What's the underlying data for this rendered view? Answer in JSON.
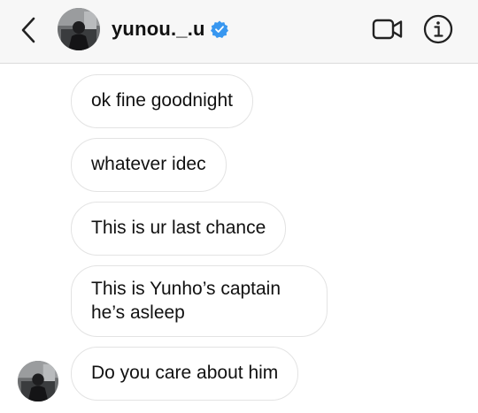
{
  "header": {
    "username": "yunou._.u",
    "verified": true,
    "icons": {
      "back": "chevron-left-icon",
      "verified": "verified-badge-icon",
      "video": "video-camera-icon",
      "info": "info-circle-icon"
    },
    "colors": {
      "verified": "#3897f0",
      "background": "#f7f7f7"
    }
  },
  "messages": [
    {
      "text": "ok fine goodnight"
    },
    {
      "text": "whatever idec"
    },
    {
      "text": "This is ur last chance"
    },
    {
      "text": "This is Yunho’s captain he’s asleep"
    },
    {
      "text": "Do you care about him"
    }
  ]
}
